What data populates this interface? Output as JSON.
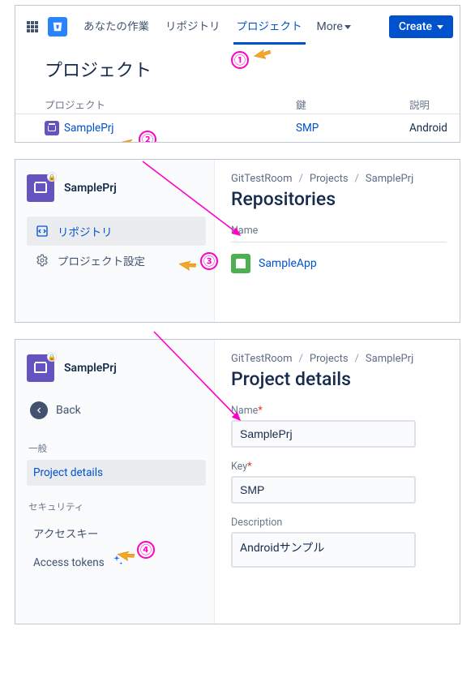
{
  "nav": {
    "your_work": "あなたの作業",
    "repositories": "リポジトリ",
    "projects": "プロジェクト",
    "more": "More",
    "create": "Create"
  },
  "panel1": {
    "title": "プロジェクト",
    "head_project": "プロジェクト",
    "head_key": "鍵",
    "head_desc": "説明",
    "row_name": "SamplePrj",
    "row_key": "SMP",
    "row_desc": "Android"
  },
  "panel2": {
    "project_name": "SamplePrj",
    "side_repos": "リポジトリ",
    "side_settings": "プロジェクト設定",
    "bc_workspace": "GitTestRoom",
    "bc_projects": "Projects",
    "bc_project": "SamplePrj",
    "heading": "Repositories",
    "col_name": "Name",
    "repo_name": "SampleApp"
  },
  "panel3": {
    "project_name": "SamplePrj",
    "back": "Back",
    "sec_general": "一般",
    "link_details": "Project details",
    "sec_security": "セキュリティ",
    "link_access_keys": "アクセスキー",
    "link_access_tokens": "Access tokens",
    "bc_workspace": "GitTestRoom",
    "bc_projects": "Projects",
    "bc_project": "SamplePrj",
    "heading": "Project details",
    "lbl_name": "Name",
    "lbl_key": "Key",
    "lbl_desc": "Description",
    "val_name": "SamplePrj",
    "val_key": "SMP",
    "val_desc": "Androidサンプル"
  },
  "anno": {
    "n1": "①",
    "n2": "②",
    "n3": "③",
    "n4": "④"
  }
}
